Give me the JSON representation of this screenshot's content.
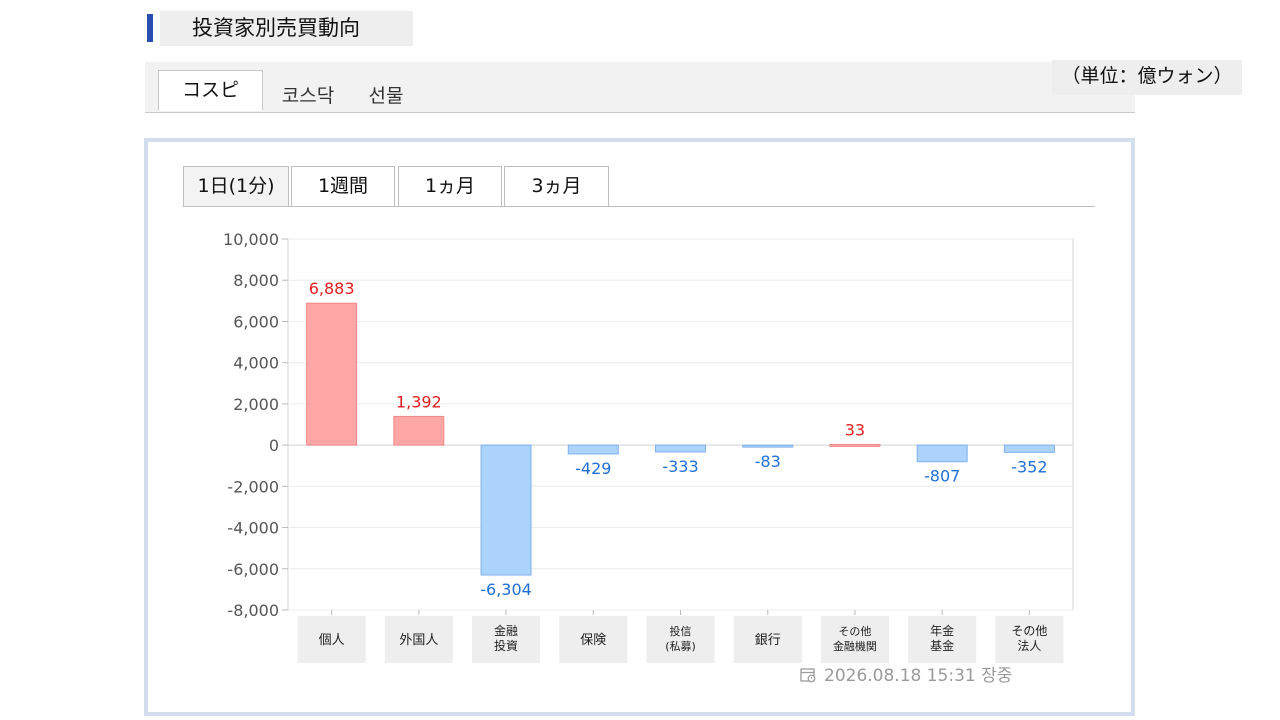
{
  "header": {
    "title": "投資家別売買動向"
  },
  "market_tabs": [
    {
      "label": "コスピ",
      "active": true
    },
    {
      "label": "코스닥",
      "active": false
    },
    {
      "label": "선물",
      "active": false
    }
  ],
  "unit_label": "（単位：億ウォン）",
  "period_tabs": [
    {
      "label": "1日(1分)",
      "active": true
    },
    {
      "label": "1週間",
      "active": false
    },
    {
      "label": "1ヵ月",
      "active": false
    },
    {
      "label": "3ヵ月",
      "active": false
    }
  ],
  "timestamp": "2026.08.18 15:31 장중",
  "colors": {
    "positive_fill": "#ffa6a6",
    "positive_text": "#e02020",
    "negative_fill": "#acd3fb",
    "negative_text": "#1f6fd6",
    "accent": "#2a4db0"
  },
  "chart_data": {
    "type": "bar",
    "title": "",
    "xlabel": "",
    "ylabel": "",
    "categories": [
      [
        "個人"
      ],
      [
        "外国人"
      ],
      [
        "金融",
        "投資"
      ],
      [
        "保険"
      ],
      [
        "投信",
        "(私募)"
      ],
      [
        "銀行"
      ],
      [
        "その他",
        "金融機関"
      ],
      [
        "年金",
        "基金"
      ],
      [
        "その他",
        "法人"
      ]
    ],
    "values": [
      6883,
      1392,
      -6304,
      -429,
      -333,
      -83,
      33,
      -807,
      -352
    ],
    "value_labels": [
      "6,883",
      "1,392",
      "-6,304",
      "-429",
      "-333",
      "-83",
      "33",
      "-807",
      "-352"
    ],
    "ylim": [
      -8000,
      10000
    ],
    "yticks": [
      10000,
      8000,
      6000,
      4000,
      2000,
      0,
      -2000,
      -4000,
      -6000,
      -8000
    ],
    "ytick_labels": [
      "10,000",
      "8,000",
      "6,000",
      "4,000",
      "2,000",
      "0",
      "-2,000",
      "-4,000",
      "-6,000",
      "-8,000"
    ],
    "grid": true,
    "legend": "none"
  }
}
